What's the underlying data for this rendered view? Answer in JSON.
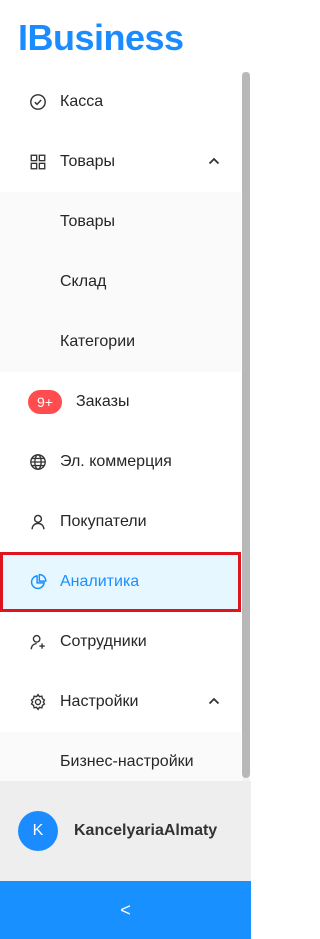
{
  "app": {
    "logo_text": "IBusiness"
  },
  "menu": {
    "kassa": "Касса",
    "tovary": "Товары",
    "tovary_sub": [
      "Товары",
      "Склад",
      "Категории"
    ],
    "zakazy_badge": "9+",
    "zakazy": "Заказы",
    "ecommerce": "Эл. коммерция",
    "pokupateli": "Покупатели",
    "analitika": "Аналитика",
    "sotrudniki": "Сотрудники",
    "nastroiki": "Настройки",
    "nastroiki_sub": [
      "Бизнес-настройки"
    ]
  },
  "user": {
    "avatar_letter": "K",
    "name": "KancelyariaAlmaty"
  },
  "footer": {
    "collapse_symbol": "<"
  },
  "colors": {
    "brand": "#1a8cff",
    "active_bg": "#e6f7ff",
    "active_text": "#1890ff",
    "highlight_border": "#e0141e",
    "badge": "#ff4d4f"
  }
}
